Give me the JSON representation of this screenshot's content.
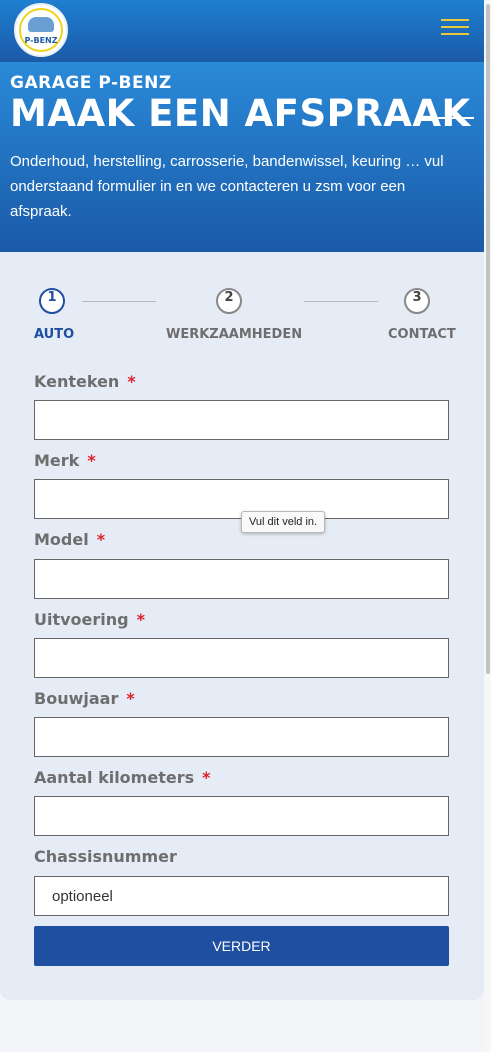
{
  "header": {
    "logo_text": "P-BENZ",
    "menu_icon": "hamburger-menu-icon"
  },
  "hero": {
    "kicker": "GARAGE P-BENZ",
    "title": "MAAK EEN AFSPRAAK",
    "intro": "Onderhoud, herstelling, carrosserie, bandenwissel, keuring … vul onderstaand formulier in en we contacteren u zsm voor een afspraak."
  },
  "steps": [
    {
      "number": "1",
      "label": "AUTO",
      "active": true
    },
    {
      "number": "2",
      "label": "WERKZAAMHEDEN",
      "active": false
    },
    {
      "number": "3",
      "label": "CONTACT",
      "active": false
    }
  ],
  "form": {
    "required_mark": "*",
    "fields": [
      {
        "label": "Kenteken",
        "required": true,
        "value": "",
        "placeholder": ""
      },
      {
        "label": "Merk",
        "required": true,
        "value": "",
        "placeholder": ""
      },
      {
        "label": "Model",
        "required": true,
        "value": "",
        "placeholder": ""
      },
      {
        "label": "Uitvoering",
        "required": true,
        "value": "",
        "placeholder": ""
      },
      {
        "label": "Bouwjaar",
        "required": true,
        "value": "",
        "placeholder": ""
      },
      {
        "label": "Aantal kilometers",
        "required": true,
        "value": "",
        "placeholder": ""
      },
      {
        "label": "Chassisnummer",
        "required": false,
        "value": "",
        "placeholder": "optioneel"
      }
    ],
    "validation_tooltip": "Vul dit veld in.",
    "submit_label": "VERDER"
  },
  "colors": {
    "brand_blue": "#1f4fa0",
    "accent_yellow": "#e8c93a",
    "required_red": "#e0202a"
  }
}
